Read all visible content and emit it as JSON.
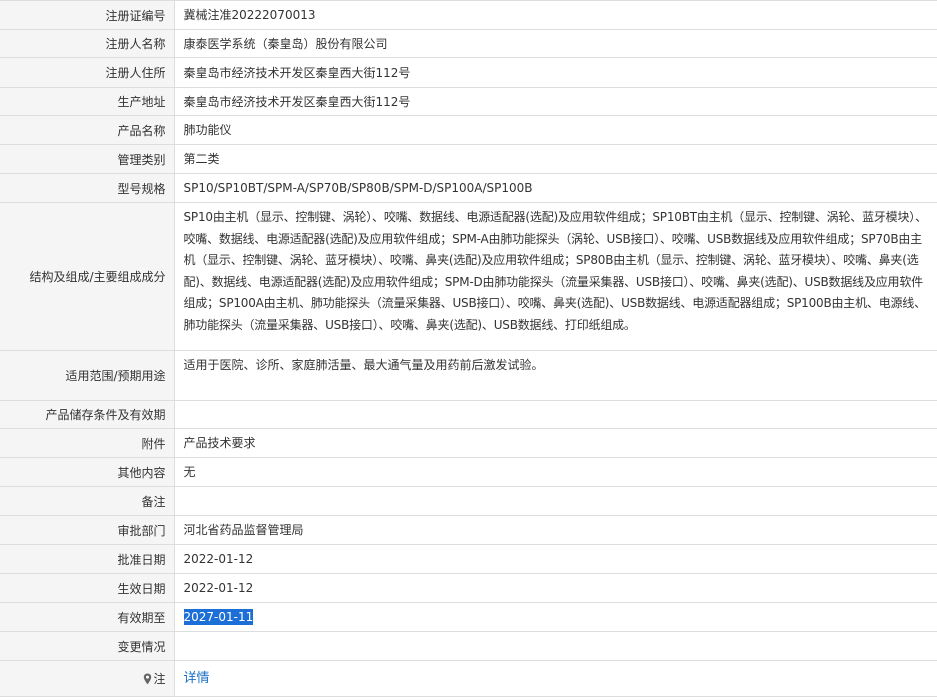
{
  "rows": [
    {
      "label": "注册证编号",
      "value": "冀械注准20222070013"
    },
    {
      "label": "注册人名称",
      "value": "康泰医学系统（秦皇岛）股份有限公司"
    },
    {
      "label": "注册人住所",
      "value": "秦皇岛市经济技术开发区秦皇西大街112号"
    },
    {
      "label": "生产地址",
      "value": "秦皇岛市经济技术开发区秦皇西大街112号"
    },
    {
      "label": "产品名称",
      "value": "肺功能仪"
    },
    {
      "label": "管理类别",
      "value": "第二类"
    },
    {
      "label": "型号规格",
      "value": "SP10/SP10BT/SPM-A/SP70B/SP80B/SPM-D/SP100A/SP100B"
    },
    {
      "label": "结构及组成/主要组成成分",
      "value": "SP10由主机（显示、控制键、涡轮）、咬嘴、数据线、电源适配器(选配)及应用软件组成；SP10BT由主机（显示、控制键、涡轮、蓝牙模块）、咬嘴、数据线、电源适配器(选配)及应用软件组成；SPM-A由肺功能探头（涡轮、USB接口）、咬嘴、USB数据线及应用软件组成；SP70B由主机（显示、控制键、涡轮、蓝牙模块）、咬嘴、鼻夹(选配)及应用软件组成；SP80B由主机（显示、控制键、涡轮、蓝牙模块）、咬嘴、鼻夹(选配)、数据线、电源适配器(选配)及应用软件组成；SPM-D由肺功能探头（流量采集器、USB接口）、咬嘴、鼻夹(选配)、USB数据线及应用软件组成；SP100A由主机、肺功能探头（流量采集器、USB接口）、咬嘴、鼻夹(选配)、USB数据线、电源适配器组成；SP100B由主机、电源线、肺功能探头（流量采集器、USB接口）、咬嘴、鼻夹(选配)、USB数据线、打印纸组成。"
    },
    {
      "label": "适用范围/预期用途",
      "value": "适用于医院、诊所、家庭肺活量、最大通气量及用药前后激发试验。"
    },
    {
      "label": "产品储存条件及有效期",
      "value": ""
    },
    {
      "label": "附件",
      "value": "产品技术要求"
    },
    {
      "label": "其他内容",
      "value": "无"
    },
    {
      "label": "备注",
      "value": ""
    },
    {
      "label": "审批部门",
      "value": "河北省药品监督管理局"
    },
    {
      "label": "批准日期",
      "value": "2022-01-12"
    },
    {
      "label": "生效日期",
      "value": "2022-01-12"
    },
    {
      "label": "有效期至",
      "value": "2027-01-11"
    },
    {
      "label": "变更情况",
      "value": ""
    },
    {
      "label": "注",
      "value": "详情"
    }
  ],
  "icons": {
    "note": "pin-icon"
  },
  "colors": {
    "label_bg": "#f5f5f5",
    "border": "#dddddd",
    "selection": "#1c6fd6",
    "link": "#1a6fc4"
  }
}
